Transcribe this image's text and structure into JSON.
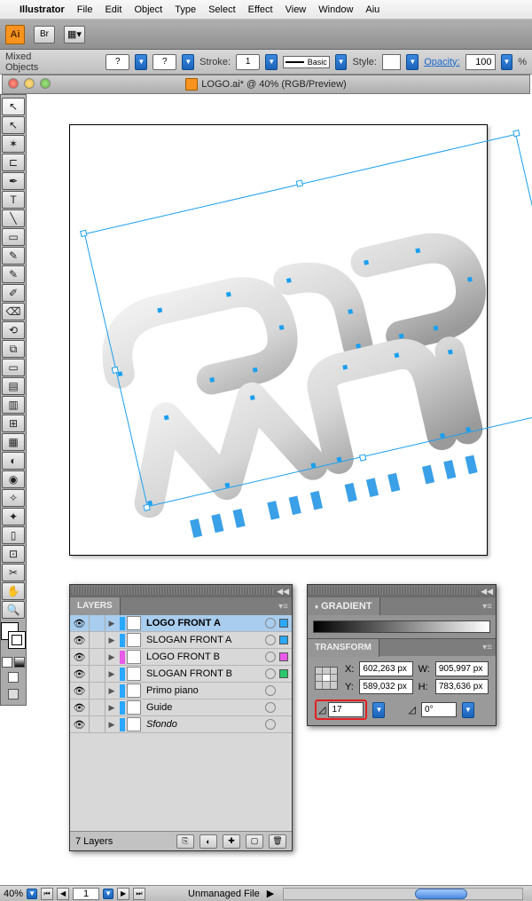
{
  "menubar": {
    "apple": "",
    "app": "Illustrator",
    "items": [
      "File",
      "Edit",
      "Object",
      "Type",
      "Select",
      "Effect",
      "View",
      "Window",
      "Aiu"
    ]
  },
  "approw1": {
    "ai": "Ai",
    "br": "Br"
  },
  "approw2": {
    "target_label": "Mixed Objects",
    "q1": "?",
    "q2": "?",
    "stroke_label": "Stroke:",
    "stroke_weight": "1",
    "style_preset": "Basic",
    "style_label": "Style:",
    "opacity_label": "Opacity:",
    "opacity": "100",
    "pct": "%"
  },
  "doc": {
    "title": "LOGO.ai* @ 40% (RGB/Preview)"
  },
  "tools": [
    "↖",
    "↖",
    "✶",
    "⊏",
    "T",
    "╲",
    "✎",
    "✎",
    "✐",
    "⟲",
    "⧉",
    "▭",
    "▤",
    "▥",
    "⊞",
    "▦",
    "◐",
    "◉",
    "✧",
    "✂",
    "✋",
    "⊡",
    "▭",
    "✋",
    "🔍"
  ],
  "layers_panel": {
    "title": "LAYERS",
    "rows": [
      {
        "name": "LOGO FRONT A",
        "color": "#2aa8ff",
        "thumb": "logo",
        "bold": true,
        "sel": true,
        "sq": "#2aa8ff"
      },
      {
        "name": "SLOGAN FRONT A",
        "color": "#2aa8ff",
        "thumb": "",
        "bold": false,
        "sel": false,
        "sq": "#2aa8ff"
      },
      {
        "name": "LOGO FRONT B",
        "color": "#e85ae8",
        "thumb": "logo",
        "bold": false,
        "sel": false,
        "sq": "#e85ae8"
      },
      {
        "name": "SLOGAN FRONT B",
        "color": "#2aa8ff",
        "thumb": "",
        "bold": false,
        "sel": false,
        "sq": "#2ac86a"
      },
      {
        "name": "Primo piano",
        "color": "#2aa8ff",
        "thumb": "",
        "bold": false,
        "sel": false,
        "sq": ""
      },
      {
        "name": "Guide",
        "color": "#2aa8ff",
        "thumb": "",
        "bold": false,
        "sel": false,
        "sq": ""
      },
      {
        "name": "Sfondo",
        "color": "#2aa8ff",
        "thumb": "",
        "bold": false,
        "sel": false,
        "sq": "",
        "italic": true
      }
    ],
    "footer": "7 Layers"
  },
  "gradient_panel": {
    "title": "GRADIENT"
  },
  "transform_panel": {
    "title": "TRANSFORM",
    "x_label": "X:",
    "x": "602,263 px",
    "y_label": "Y:",
    "y": "589,032 px",
    "w_label": "W:",
    "w": "905,997 px",
    "h_label": "H:",
    "h": "783,636 px",
    "rot_label": "⊿:",
    "rotation": "17",
    "shear_label": "⊿:",
    "shear": "0°"
  },
  "status": {
    "zoom": "40%",
    "page": "1",
    "msg": "Unmanaged File"
  }
}
